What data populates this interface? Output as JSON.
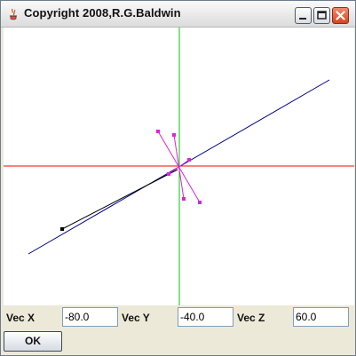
{
  "window": {
    "title": "Copyright 2008,R.G.Baldwin"
  },
  "controls": {
    "vec_x": {
      "label": "Vec X",
      "value": "-80.0"
    },
    "vec_y": {
      "label": "Vec Y",
      "value": "-40.0"
    },
    "vec_z": {
      "label": "Vec Z",
      "value": "60.0"
    },
    "ok_label": "OK"
  },
  "colors": {
    "x_axis": "#ff0000",
    "y_axis": "#00cc00",
    "z_axis": "#00008b",
    "marker": "#e020e0",
    "vector": "#000000"
  }
}
